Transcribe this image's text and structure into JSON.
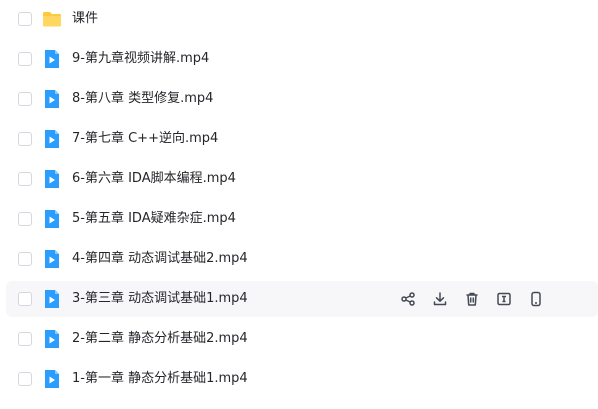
{
  "files": [
    {
      "name": "课件",
      "type": "folder"
    },
    {
      "name": "9-第九章视频讲解.mp4",
      "type": "video"
    },
    {
      "name": "8-第八章 类型修复.mp4",
      "type": "video"
    },
    {
      "name": "7-第七章 C++逆向.mp4",
      "type": "video"
    },
    {
      "name": "6-第六章 IDA脚本编程.mp4",
      "type": "video"
    },
    {
      "name": "5-第五章 IDA疑难杂症.mp4",
      "type": "video"
    },
    {
      "name": "4-第四章 动态调试基础2.mp4",
      "type": "video"
    },
    {
      "name": "3-第三章 动态调试基础1.mp4",
      "type": "video"
    },
    {
      "name": "2-第二章 静态分析基础2.mp4",
      "type": "video"
    },
    {
      "name": "1-第一章 静态分析基础1.mp4",
      "type": "video"
    }
  ],
  "hovered_row": 7,
  "row_actions": [
    "share-icon",
    "download-icon",
    "delete-icon",
    "rename-icon",
    "mobile-icon"
  ],
  "colors": {
    "folder": "#ffc93c",
    "video": "#2a9dff",
    "icon": "#444a55"
  }
}
